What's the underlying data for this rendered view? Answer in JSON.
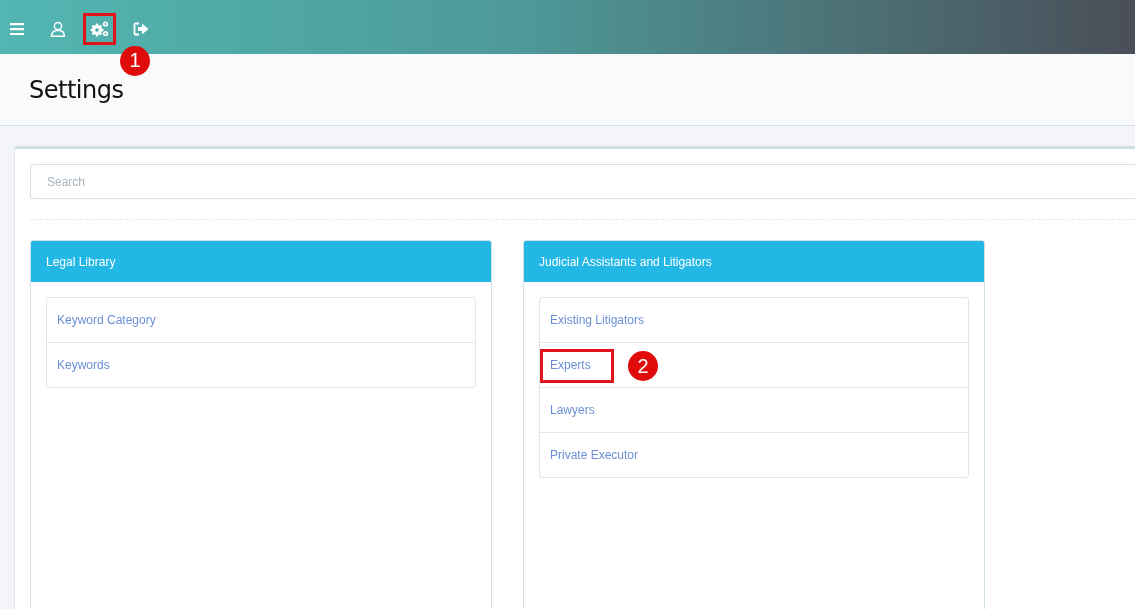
{
  "toolbar": {
    "buttons": [
      {
        "kind": "menu",
        "highlighted": false
      },
      {
        "kind": "user",
        "highlighted": false
      },
      {
        "kind": "settings",
        "highlighted": true,
        "callout": "1"
      },
      {
        "kind": "logout",
        "highlighted": false
      }
    ]
  },
  "page": {
    "title": "Settings"
  },
  "search": {
    "placeholder": "Search"
  },
  "panels": [
    {
      "title": "Legal Library",
      "items": [
        {
          "label": "Keyword Category",
          "highlighted": false
        },
        {
          "label": "Keywords",
          "highlighted": false
        }
      ]
    },
    {
      "title": "Judicial Assistants and Litigators",
      "items": [
        {
          "label": "Existing Litigators",
          "highlighted": false
        },
        {
          "label": "Experts",
          "highlighted": true,
          "callout": "2"
        },
        {
          "label": "Lawyers",
          "highlighted": false
        },
        {
          "label": "Private Executor",
          "highlighted": false
        }
      ]
    }
  ]
}
